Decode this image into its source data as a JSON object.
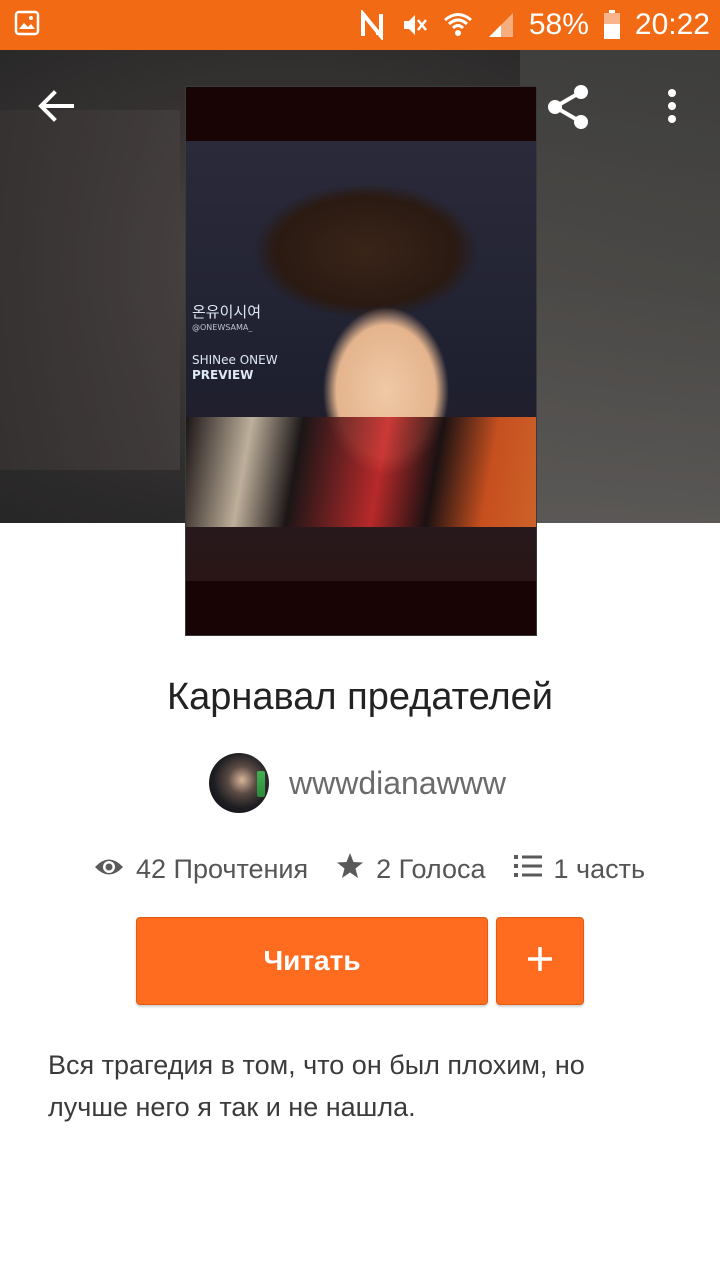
{
  "status_bar": {
    "battery_percent": "58%",
    "time": "20:22",
    "icons": [
      "gallery-icon",
      "nfc-icon",
      "mute-icon",
      "wifi-icon",
      "signal-icon",
      "battery-icon"
    ],
    "background_color": "#f26a14"
  },
  "toolbar": {
    "icons": [
      "back-arrow-icon",
      "share-icon",
      "more-vert-icon"
    ]
  },
  "cover": {
    "caption_line1": "온유이시여",
    "caption_line2": "@ONEWSAMA_",
    "caption_line3": "SHINee ONEW",
    "caption_line4": "PREVIEW"
  },
  "story": {
    "title": "Карнавал предателей",
    "author": "wwwdianawww",
    "description": "Вся трагедия в том, что он был плохим, но лучше него я так и не нашла."
  },
  "stats": {
    "reads": "42 Прочтения",
    "votes": "2 Голоса",
    "parts": "1 часть"
  },
  "actions": {
    "read_label": "Читать",
    "add_icon": "plus-icon",
    "accent_color": "#ff6b1f"
  }
}
